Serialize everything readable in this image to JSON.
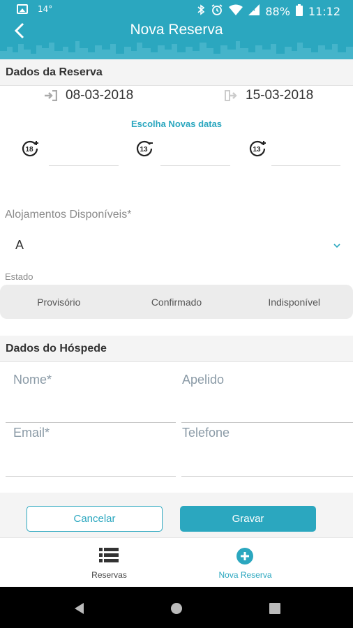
{
  "status_bar": {
    "temperature": "14°",
    "battery": "88%",
    "time": "11:12"
  },
  "app_bar": {
    "title": "Nova Reserva"
  },
  "reservation": {
    "section_title": "Dados da Reserva",
    "check_in": "08-03-2018",
    "check_out": "15-03-2018",
    "choose_dates_link": "Escolha Novas datas",
    "age_groups": [
      {
        "icon": "age-18-plus-icon",
        "badge": "18",
        "value": ""
      },
      {
        "icon": "age-13-minus-icon",
        "badge": "13",
        "value": ""
      },
      {
        "icon": "age-13-plus-icon",
        "badge": "13",
        "value": ""
      }
    ],
    "accommodations_label": "Alojamentos Disponíveis*",
    "accommodation_selected": "A",
    "state_label": "Estado",
    "state_options": [
      "Provisório",
      "Confirmado",
      "Indisponível"
    ]
  },
  "guest": {
    "section_title": "Dados do Hóspede",
    "name_placeholder": "Nome*",
    "surname_placeholder": "Apelido",
    "email_placeholder": "Email*",
    "phone_placeholder": "Telefone"
  },
  "actions": {
    "cancel_label": "Cancelar",
    "save_label": "Gravar"
  },
  "bottom_nav": {
    "items": [
      {
        "label": "Reservas",
        "icon": "list-icon",
        "active": false
      },
      {
        "label": "Nova Reserva",
        "icon": "add-circle-icon",
        "active": true
      }
    ]
  },
  "colors": {
    "accent": "#2ba7bf",
    "section_bg": "#f4f4f4",
    "segment_bg": "#ececec"
  }
}
